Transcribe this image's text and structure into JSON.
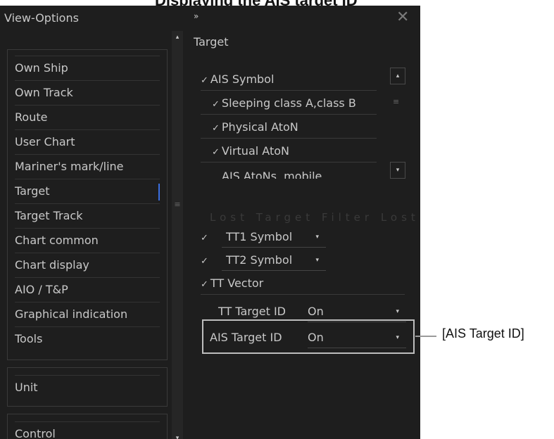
{
  "caption": "Displaying the AIS target ID",
  "window": {
    "title": "View-Options",
    "expand_icon": "»",
    "close_icon": "✕"
  },
  "nav": {
    "items": [
      "Own Ship",
      "Own Track",
      "Route",
      "User Chart",
      "Mariner's mark/line",
      "Target",
      "Target Track",
      "Chart common",
      "Chart display",
      "AIO / T&P",
      "Graphical indication",
      "Tools"
    ],
    "active": "Target",
    "unit": "Unit",
    "control": "Control"
  },
  "main": {
    "section_title": "Target",
    "ais_items": [
      {
        "label": "AIS Symbol",
        "checked": true,
        "level": 0
      },
      {
        "label": "Sleeping class A,class B",
        "checked": true,
        "level": 1
      },
      {
        "label": "Physical AtoN",
        "checked": true,
        "level": 1
      },
      {
        "label": "Virtual AtoN",
        "checked": true,
        "level": 1
      },
      {
        "label": "AIS AtoNs, mobile",
        "checked": false,
        "level": 1
      }
    ],
    "faded_row": "Lost    Target    Filter    Lost",
    "tt1": {
      "checked": true,
      "label": "TT1 Symbol"
    },
    "tt2": {
      "checked": true,
      "label": "TT2 Symbol"
    },
    "tt_vector": {
      "checked": true,
      "label": "TT Vector"
    },
    "tt_target_id": {
      "label": "TT Target ID",
      "value": "On"
    },
    "ais_target_id": {
      "label": "AIS Target ID",
      "value": "On"
    }
  },
  "callout_label": "[AIS Target ID]",
  "icons": {
    "check": "✓",
    "caret_down": "▾",
    "caret_up": "▴",
    "grip": "≡"
  }
}
